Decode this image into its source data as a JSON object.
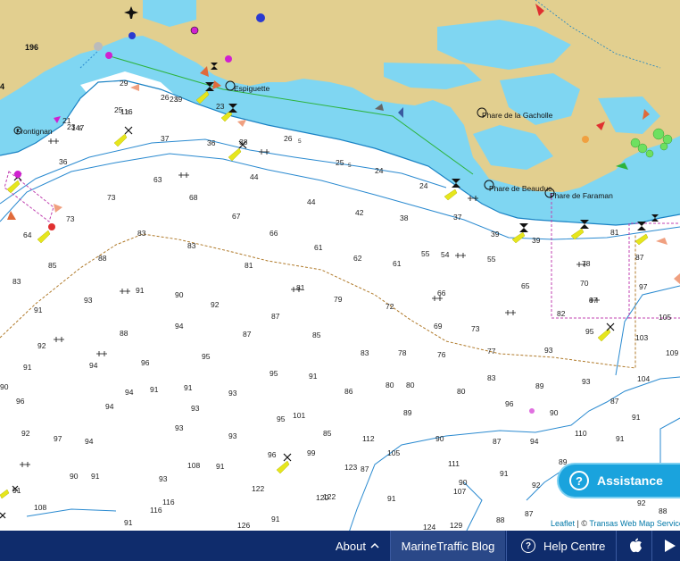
{
  "map": {
    "place_labels": {
      "frontignan": "Frontignan",
      "espiguette": "Espiguette",
      "phare_gacholle": "Phare de la Gacholle",
      "phare_beauduc": "Phare de Beauduc",
      "phare_faraman": "Phare de Faraman"
    },
    "contour_label": "196",
    "depths": [
      "23",
      "5",
      "21",
      "29",
      "25",
      "5",
      "26",
      "5",
      "23",
      "37",
      "36",
      "38",
      "26",
      "5",
      "25",
      "5",
      "36",
      "63",
      "24",
      "44",
      "73",
      "68",
      "24",
      "44",
      "67",
      "42",
      "38",
      "37",
      "39",
      "39",
      "81",
      "73",
      "64",
      "66",
      "61",
      "55",
      "54",
      "55",
      "87",
      "83",
      "83",
      "88",
      "85",
      "81",
      "62",
      "61",
      "65",
      "78",
      "83",
      "81",
      "66",
      "90",
      "93",
      "91",
      "92",
      "87",
      "79",
      "72",
      "69",
      "73",
      "91",
      "70",
      "97",
      "82",
      "92",
      "95",
      "87",
      "93",
      "94",
      "88",
      "87",
      "85",
      "103",
      "105",
      "94",
      "96",
      "95",
      "83",
      "78",
      "76",
      "77",
      "109",
      "91",
      "96",
      "93",
      "91",
      "94",
      "95",
      "80",
      "80",
      "83",
      "104",
      "90",
      "91",
      "93",
      "86",
      "80",
      "89",
      "96",
      "94",
      "91",
      "95",
      "87",
      "92",
      "93",
      "101",
      "89",
      "90",
      "85",
      "91",
      "97",
      "94",
      "93",
      "93",
      "90",
      "87",
      "94",
      "110",
      "112",
      "105",
      "96",
      "99",
      "91",
      "108",
      "91",
      "87",
      "111",
      "89",
      "90",
      "91",
      "93",
      "123",
      "107",
      "90",
      "91",
      "92",
      "91",
      "122",
      "122",
      "120",
      "116",
      "116",
      "91",
      "91",
      "108",
      "91",
      "88",
      "87",
      "92",
      "88",
      "126",
      "124",
      "129",
      "147",
      "116",
      "239",
      "121",
      "5",
      "5",
      "5"
    ],
    "vessel_count_label": "4"
  },
  "assistance": {
    "label": "Assistance",
    "icon": "question-circle-icon"
  },
  "attribution": {
    "leaflet": "Leaflet",
    "sep": " | © ",
    "transas": "Transas Web Map Service"
  },
  "footer": {
    "about": "About",
    "blog": "MarineTraffic Blog",
    "help": "Help Centre",
    "apple_icon": "apple-icon",
    "android_icon": "play-store-icon"
  },
  "colors": {
    "land": "#e2cf8f",
    "shallow": "#7fd6f2",
    "deep": "#ffffff",
    "footer": "#0f2c6c",
    "assist": "#1aa3dd"
  }
}
